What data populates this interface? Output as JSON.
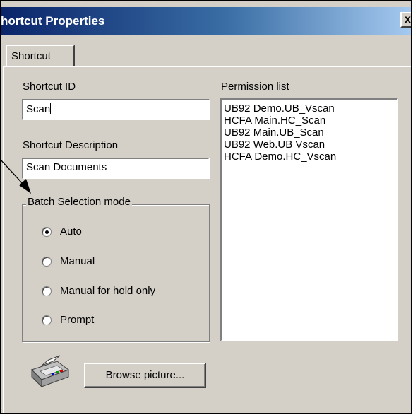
{
  "window": {
    "title": "hortcut Properties",
    "close_glyph": "x"
  },
  "tabs": [
    {
      "label": "Shortcut"
    }
  ],
  "form": {
    "shortcut_id_label": "Shortcut ID",
    "shortcut_id_value": "Scan",
    "shortcut_desc_label": "Shortcut Description",
    "shortcut_desc_value": "Scan Documents",
    "permission_label": "Permission list"
  },
  "batch_mode": {
    "legend": "Batch Selection mode",
    "options": [
      {
        "label": "Auto",
        "checked": true
      },
      {
        "label": "Manual",
        "checked": false
      },
      {
        "label": "Manual for hold only",
        "checked": false
      },
      {
        "label": "Prompt",
        "checked": false
      }
    ]
  },
  "permissions": [
    "UB92 Demo.UB_Vscan",
    "HCFA  Main.HC_Scan",
    "UB92 Main.UB_Scan",
    "UB92  Web.UB Vscan",
    "HCFA Demo.HC_Vscan"
  ],
  "browse_button": "Browse picture...",
  "icons": {
    "picture": "printer-icon",
    "annotation": "annotation-arrow"
  },
  "colors": {
    "titlebar_start": "#0a246a",
    "titlebar_end": "#a6caf0",
    "face": "#d4d0c8"
  }
}
